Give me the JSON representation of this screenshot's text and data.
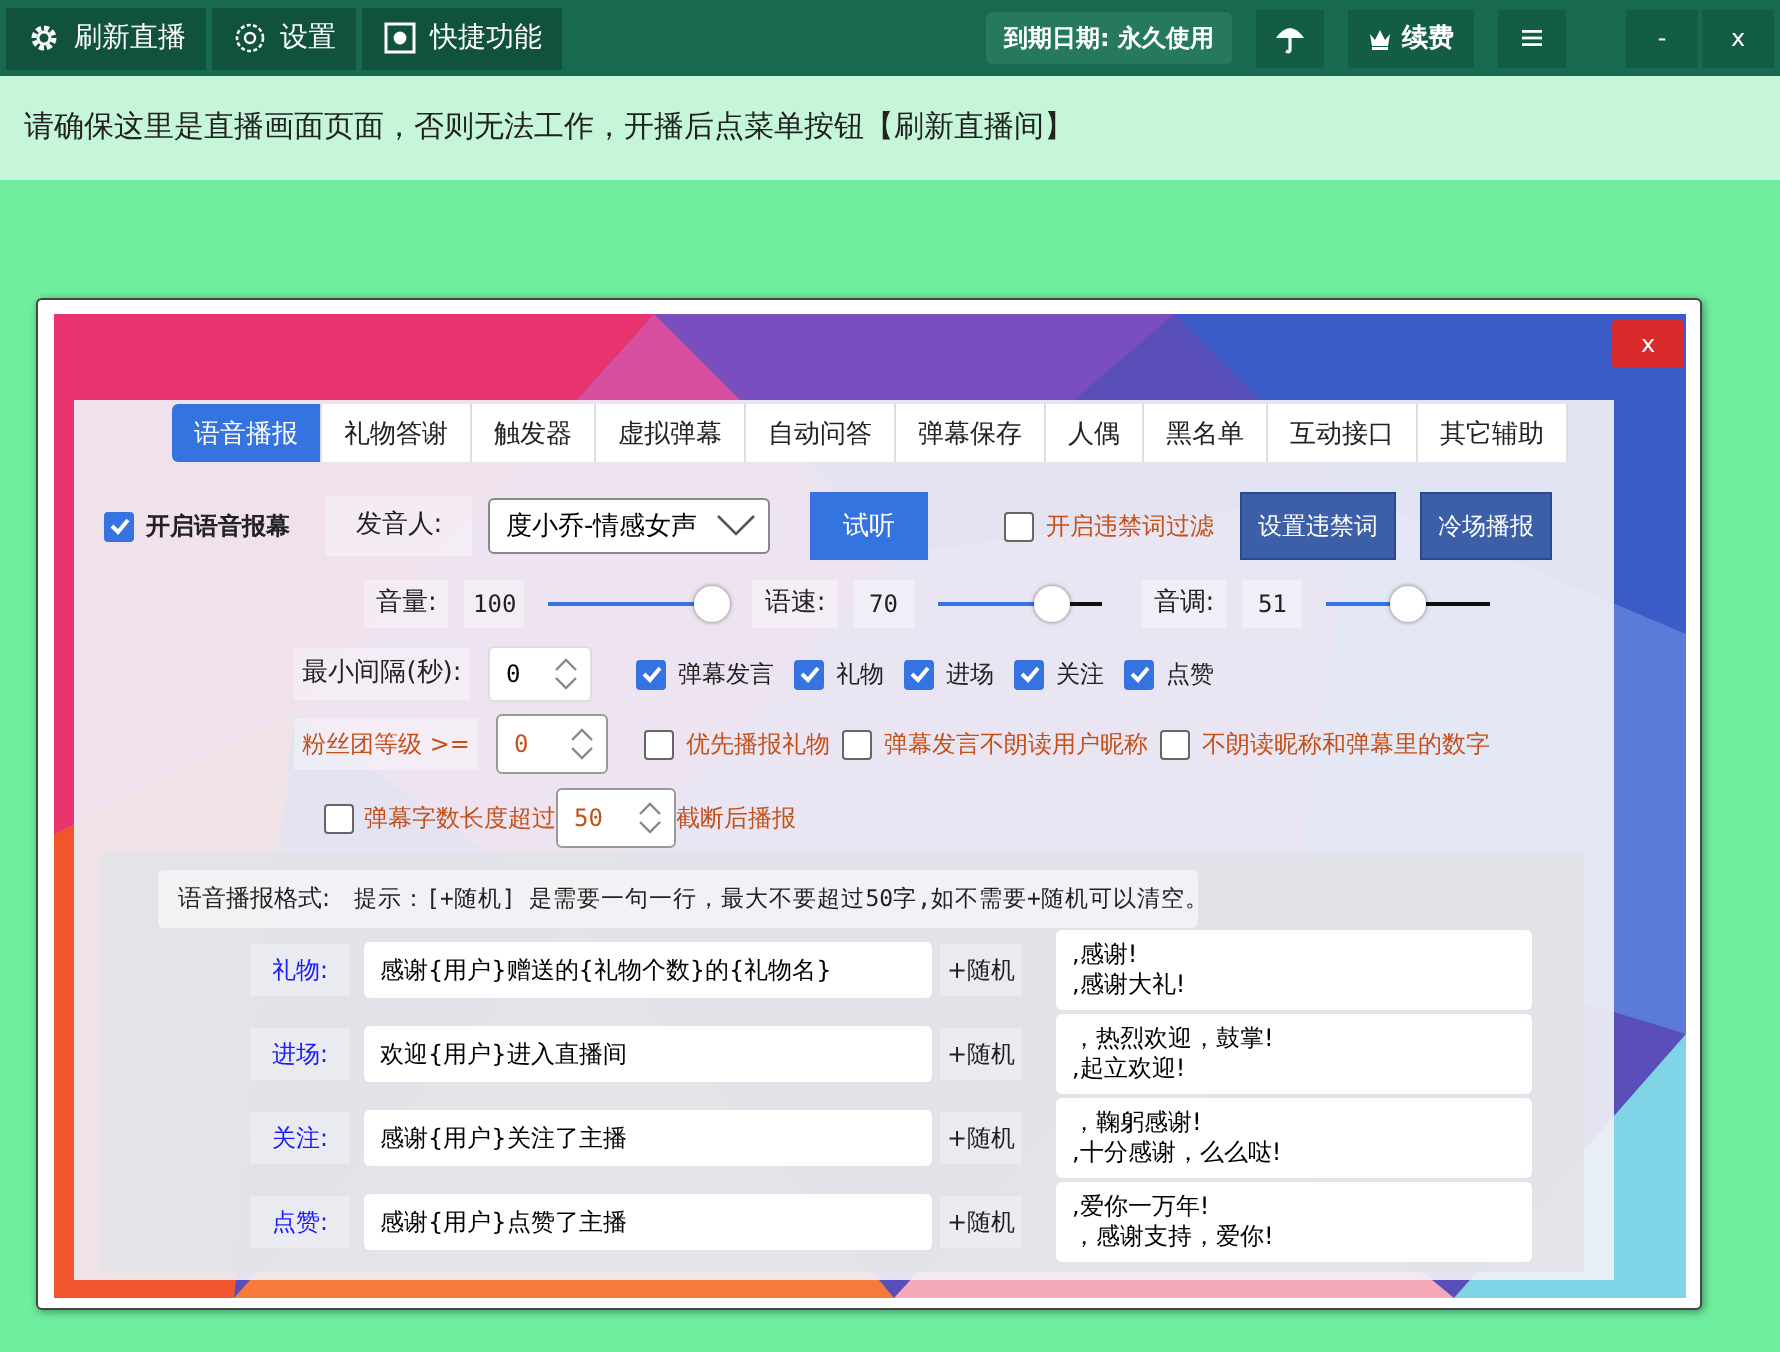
{
  "toolbar": {
    "buttons": [
      {
        "label": "刷新直播"
      },
      {
        "label": "设置"
      },
      {
        "label": "快捷功能"
      }
    ],
    "expiry": "到期日期: 永久使用",
    "renew": "续费",
    "minimize": "-",
    "close": "x"
  },
  "notice": "请确保这里是直播画面页面，否则无法工作，开播后点菜单按钮【刷新直播间】",
  "dialog": {
    "close": "x",
    "tabs": [
      {
        "label": "语音播报",
        "selected": true
      },
      {
        "label": "礼物答谢",
        "selected": false
      },
      {
        "label": "触发器",
        "selected": false
      },
      {
        "label": "虚拟弹幕",
        "selected": false
      },
      {
        "label": "自动问答",
        "selected": false
      },
      {
        "label": "弹幕保存",
        "selected": false
      },
      {
        "label": "人偶",
        "selected": false
      },
      {
        "label": "黑名单",
        "selected": false
      },
      {
        "label": "互动接口",
        "selected": false
      },
      {
        "label": "其它辅助",
        "selected": false
      }
    ],
    "enable": {
      "label": "开启语音报幕",
      "checked": true
    },
    "voice_label": "发音人:",
    "voice": "度小乔-情感女声",
    "test_button": "试听",
    "filter": {
      "label": "开启违禁词过滤",
      "checked": false
    },
    "buttons": [
      "设置违禁词",
      "冷场播报"
    ],
    "sliders": [
      {
        "label": "音量:",
        "reading": "100",
        "level": 1.0
      },
      {
        "label": "语速:",
        "reading": "70",
        "level": 0.7
      },
      {
        "label": "音调:",
        "reading": "51",
        "level": 0.5
      }
    ],
    "interval": {
      "label": "最小间隔(秒):",
      "value": "0"
    },
    "events": [
      {
        "label": "弹幕发言",
        "checked": true
      },
      {
        "label": "礼物",
        "checked": true
      },
      {
        "label": "进场",
        "checked": true
      },
      {
        "label": "关注",
        "checked": true
      },
      {
        "label": "点赞",
        "checked": true
      }
    ],
    "fan_level": {
      "label": "粉丝团等级 >=",
      "value": "0"
    },
    "options": [
      {
        "label": "优先播报礼物",
        "checked": false
      },
      {
        "label": "弹幕发言不朗读用户昵称",
        "checked": false
      },
      {
        "label": "不朗读昵称和弹幕里的数字",
        "checked": false
      }
    ],
    "length": {
      "label": "弹幕字数长度超过",
      "checked": false,
      "value": "50",
      "after": "截断后播报"
    },
    "format_label": "语音播报格式:",
    "hint": "提示：[+随机] 是需要一句一行，最大不要超过50字,如不需要+随机可以清空。",
    "rows": [
      {
        "label": "礼物:",
        "template": "感谢{用户}赠送的{礼物个数}的{礼物名}",
        "random_label": "+随机",
        "random": [
          ",感谢!",
          ",感谢大礼!"
        ]
      },
      {
        "label": "进场:",
        "template": "欢迎{用户}进入直播间",
        "random_label": "+随机",
        "random": [
          "，热烈欢迎，鼓掌!",
          ",起立欢迎!"
        ]
      },
      {
        "label": "关注:",
        "template": "感谢{用户}关注了主播",
        "random_label": "+随机",
        "random": [
          "，鞠躬感谢!",
          ",十分感谢，么么哒!"
        ]
      },
      {
        "label": "点赞:",
        "template": "感谢{用户}点赞了主播",
        "random_label": "+随机",
        "random": [
          ",爱你一万年!",
          "，感谢支持，爱你!"
        ]
      }
    ]
  }
}
